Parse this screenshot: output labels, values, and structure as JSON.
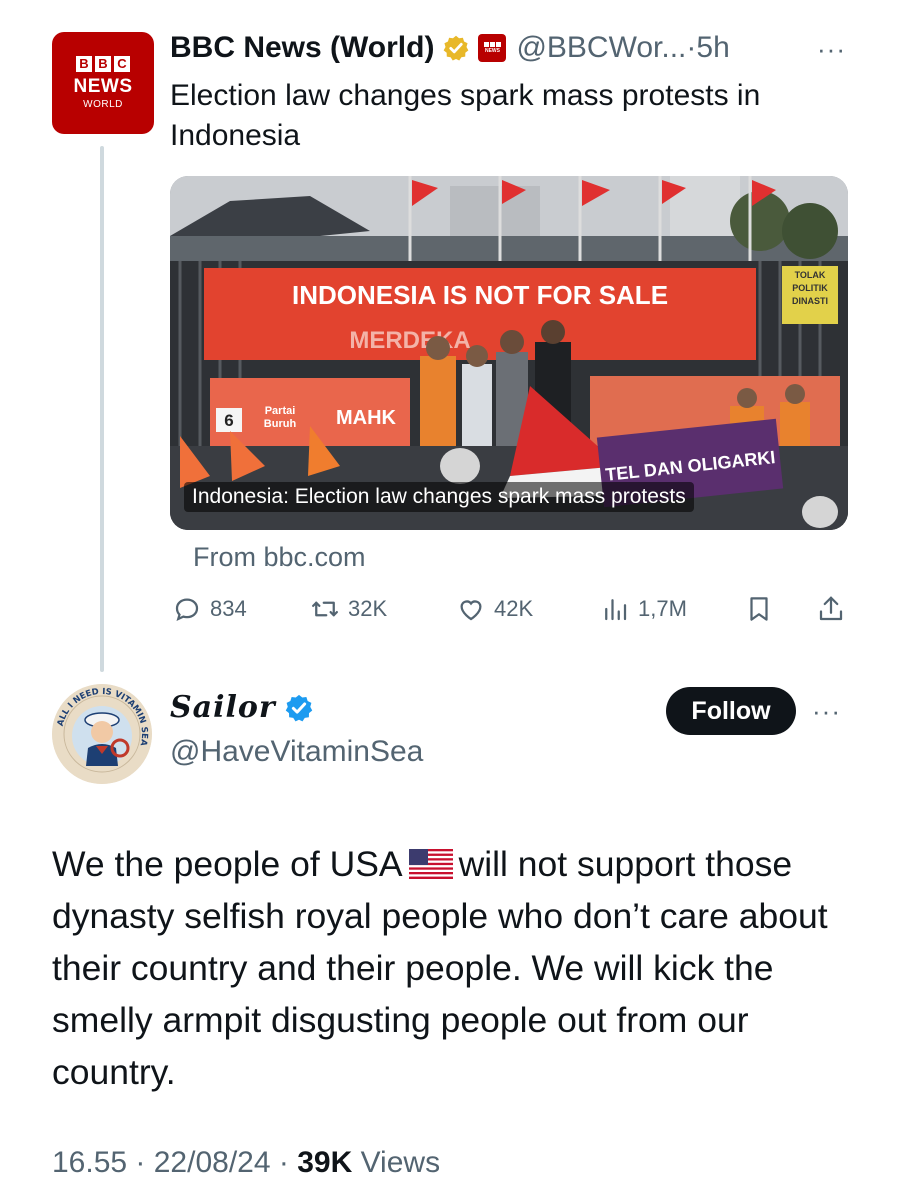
{
  "parent_tweet": {
    "avatar": {
      "blocks": [
        "B",
        "B",
        "C"
      ],
      "line1": "NEWS",
      "line2": "WORLD"
    },
    "display_name": "BBC News (World)",
    "handle": "@BBCWor...",
    "time_separator": " · ",
    "time": "5h",
    "more": "···",
    "text": "Election law changes spark mass protests in Indonesia",
    "media": {
      "banner_main": "INDONESIA IS NOT FOR SALE",
      "banner_sub": "MERDEKA",
      "sign_yellow": [
        "TOLAK",
        "POLITIK",
        "DINASTI"
      ],
      "banner_party": [
        "Partai",
        "Buruh"
      ],
      "party_number": "6",
      "banner_mahk": "MAHK",
      "banner_purple": "TEL DAN OLIGARKI",
      "caption": "Indonesia: Election law changes spark mass protests"
    },
    "link_source": "From bbc.com",
    "metrics": {
      "replies": "834",
      "reposts": "32K",
      "likes": "42K",
      "views": "1,7M"
    }
  },
  "reply_tweet": {
    "avatar": {
      "ring_text": "ALL I NEED IS VITAMIN SEA"
    },
    "display_name": "Sailor",
    "handle": "@HaveVitaminSea",
    "follow_label": "Follow",
    "more": "···",
    "text_part1": "We the people of USA",
    "text_part2": "will not support those dynasty selfish royal people who don’t care about their country and their people. We will kick the smelly armpit disgusting people out from our country.",
    "footer": {
      "time": "16.55",
      "date": "22/08/24",
      "views_count": "39K",
      "views_label": "Views",
      "sep": " · "
    }
  },
  "colors": {
    "bbc_red": "#b80000",
    "text_primary": "#0f1419",
    "text_secondary": "#536471",
    "verified_blue": "#1d9bf0",
    "verified_gold": "#e8b829"
  }
}
